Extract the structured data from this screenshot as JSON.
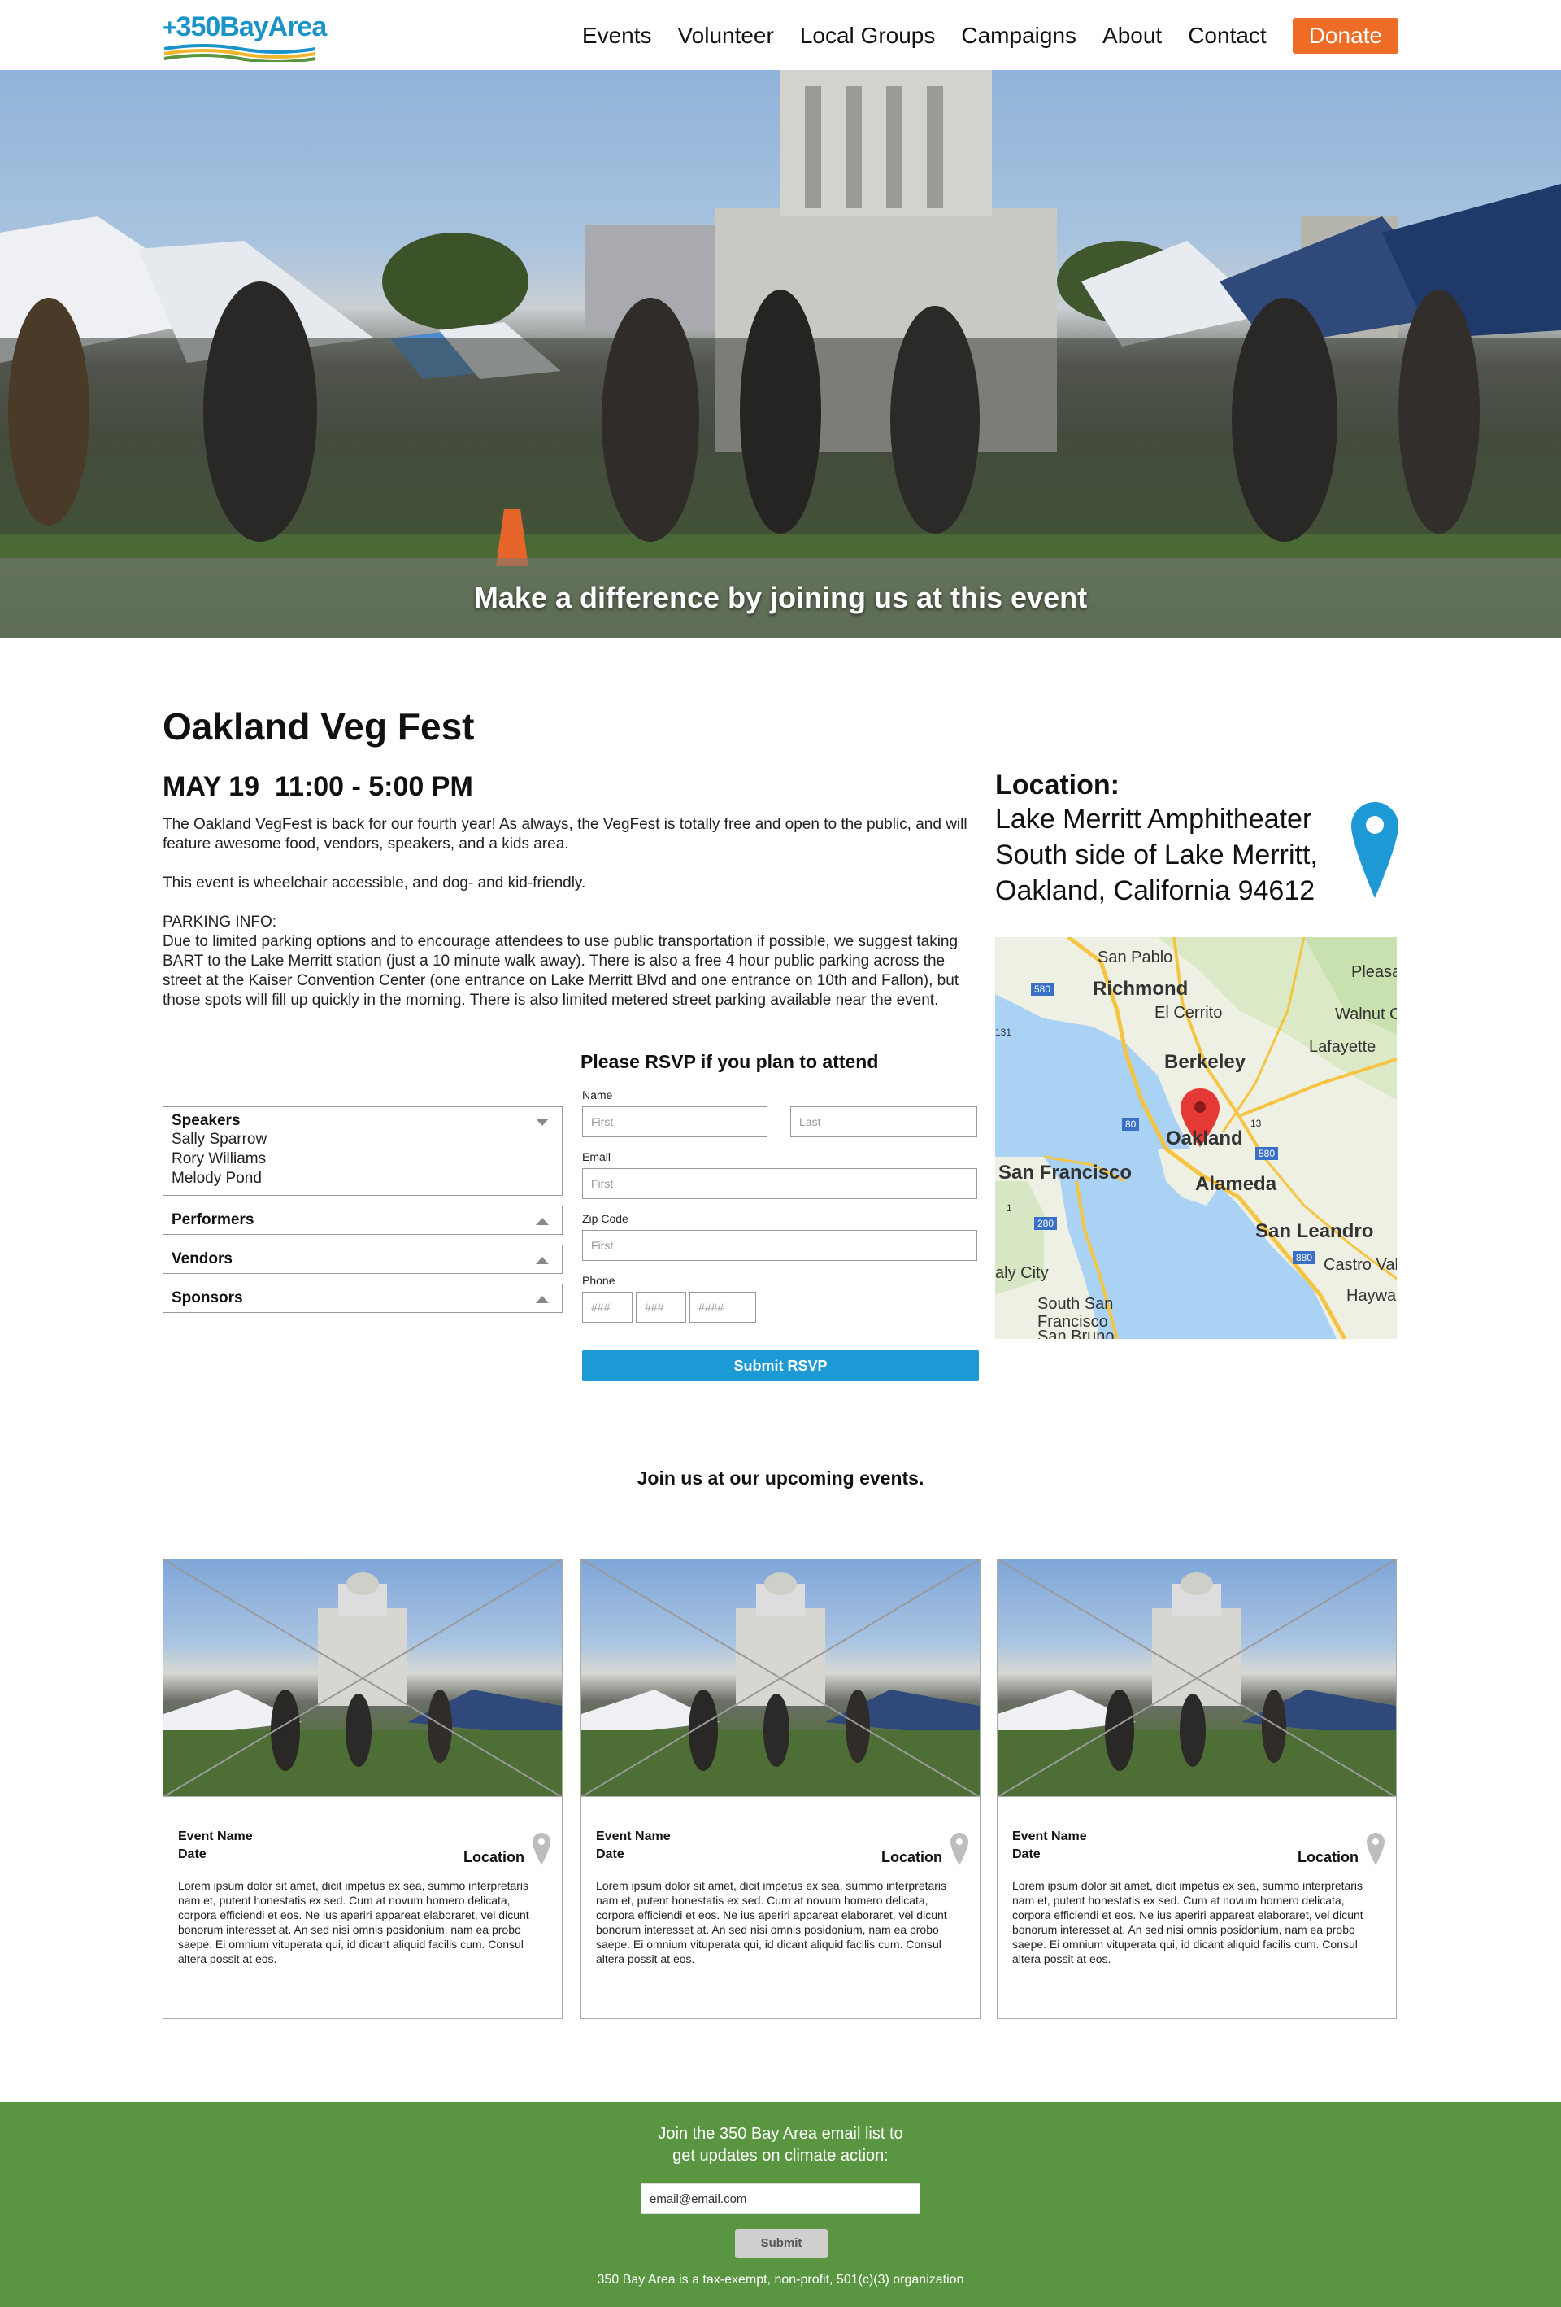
{
  "header": {
    "logo_text": "350BayArea",
    "logo_plus": "+",
    "nav": [
      "Events",
      "Volunteer",
      "Local Groups",
      "Campaigns",
      "About",
      "Contact"
    ],
    "donate": "Donate"
  },
  "hero": {
    "caption": "Make a difference by joining us at this event"
  },
  "event": {
    "title": "Oakland Veg Fest",
    "date": "MAY 19  11:00 - 5:00 PM",
    "description": [
      "The Oakland VegFest is back for our fourth year! As always, the VegFest is totally free and open to the public, and will feature awesome food, vendors, speakers, and a kids area.",
      "This event is wheelchair accessible, and dog- and kid-friendly."
    ],
    "parking_heading": "PARKING INFO:",
    "parking_text": "Due to limited parking options and to encourage attendees to use public transportation if possible, we suggest taking BART to the Lake Merritt station (just a 10 minute walk away). There is also a free 4 hour public parking across the street at the Kaiser Convention Center (one entrance on Lake Merritt Blvd and one entrance on 10th and Fallon), but those spots will fill up quickly in the morning. There is also limited metered street parking available near the event."
  },
  "location": {
    "label": "Location:",
    "lines": [
      "Lake Merritt Amphitheater",
      "South side of Lake Merritt,",
      "Oakland, California 94612"
    ]
  },
  "map": {
    "labels": [
      "San Pablo",
      "Richmond",
      "El Cerrito",
      "Berkeley",
      "Oakland",
      "Alameda",
      "San Francisco",
      "San Leandro",
      "Castro Vall",
      "Haywar",
      "aly City",
      "South San",
      "Francisco",
      "San Bruno",
      "Lafayette",
      "Walnut C",
      "Pleasan",
      "580",
      "80",
      "880",
      "280",
      "131",
      "13",
      "1",
      "580"
    ]
  },
  "accordions": [
    {
      "title": "Speakers",
      "expanded": true,
      "items": [
        "Sally Sparrow",
        "Rory Williams",
        "Melody Pond"
      ]
    },
    {
      "title": "Performers",
      "expanded": false,
      "items": []
    },
    {
      "title": "Vendors",
      "expanded": false,
      "items": []
    },
    {
      "title": "Sponsors",
      "expanded": false,
      "items": []
    }
  ],
  "rsvp": {
    "title": "Please RSVP if you plan to attend",
    "name_label": "Name",
    "first_placeholder": "First",
    "last_placeholder": "Last",
    "email_label": "Email",
    "email_placeholder": "First",
    "zip_label": "Zip Code",
    "zip_placeholder": "First",
    "phone_label": "Phone",
    "phone_placeholders": [
      "###",
      "###",
      "####"
    ],
    "submit": "Submit RSVP"
  },
  "upcoming": {
    "title": "Join us at our upcoming events.",
    "cards": [
      {
        "name": "Event Name",
        "date": "Date",
        "location": "Location",
        "text": "Lorem ipsum dolor sit amet, dicit impetus ex sea, summo interpretaris nam et, putent honestatis ex sed. Cum at novum homero delicata, corpora efficiendi et eos. Ne ius aperiri appareat elaboraret, vel dicunt bonorum interesset at. An sed nisi omnis posidonium, nam ea probo saepe. Ei omnium vituperata qui, id dicant aliquid facilis cum. Consul altera possit at eos."
      },
      {
        "name": "Event Name",
        "date": "Date",
        "location": "Location",
        "text": "Lorem ipsum dolor sit amet, dicit impetus ex sea, summo interpretaris nam et, putent honestatis ex sed. Cum at novum homero delicata, corpora efficiendi et eos. Ne ius aperiri appareat elaboraret, vel dicunt bonorum interesset at. An sed nisi omnis posidonium, nam ea probo saepe. Ei omnium vituperata qui, id dicant aliquid facilis cum. Consul altera possit at eos."
      },
      {
        "name": "Event Name",
        "date": "Date",
        "location": "Location",
        "text": "Lorem ipsum dolor sit amet, dicit impetus ex sea, summo interpretaris nam et, putent honestatis ex sed. Cum at novum homero delicata, corpora efficiendi et eos. Ne ius aperiri appareat elaboraret, vel dicunt bonorum interesset at. An sed nisi omnis posidonium, nam ea probo saepe. Ei omnium vituperata qui, id dicant aliquid facilis cum. Consul altera possit at eos."
      }
    ]
  },
  "footer": {
    "text_line1": "Join the 350 Bay Area email list to",
    "text_line2": "get updates on climate action:",
    "email_value": "email@email.com",
    "submit": "Submit",
    "small": "350 Bay Area is a tax-exempt, non-profit, 501(c)(3) organization"
  },
  "colors": {
    "brand_blue": "#1a94c8",
    "donate_orange": "#ee6c25",
    "rsvp_blue": "#1c9ad6",
    "footer_green": "#5a9642",
    "pin_blue": "#1d9ad6",
    "map_pin_red": "#e53935"
  }
}
